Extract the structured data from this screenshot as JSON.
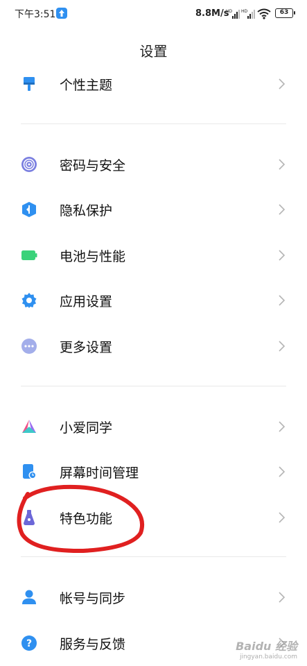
{
  "status_bar": {
    "time": "下午3:51",
    "speed": "8.8M/s",
    "battery": "63",
    "colors": {
      "notification": "#2f90f0"
    }
  },
  "header": {
    "title": "设置"
  },
  "groups": [
    {
      "items": [
        {
          "label": "个性主题",
          "icon": "theme-brush-icon",
          "color": "#2f90f0"
        }
      ]
    },
    {
      "items": [
        {
          "label": "密码与安全",
          "icon": "fingerprint-icon",
          "color": "#7a7fe0"
        },
        {
          "label": "隐私保护",
          "icon": "privacy-shield-icon",
          "color": "#2f90f0"
        },
        {
          "label": "电池与性能",
          "icon": "battery-icon",
          "color": "#3ad27a"
        },
        {
          "label": "应用设置",
          "icon": "gear-icon",
          "color": "#2f90f0"
        },
        {
          "label": "更多设置",
          "icon": "more-dots-icon",
          "color": "#a3aeea"
        }
      ]
    },
    {
      "items": [
        {
          "label": "小爱同学",
          "icon": "xiaoai-icon",
          "color": "#3ec9c9"
        },
        {
          "label": "屏幕时间管理",
          "icon": "screen-time-icon",
          "color": "#2f90f0"
        },
        {
          "label": "特色功能",
          "icon": "feature-flask-icon",
          "color": "#6c67d8"
        }
      ]
    },
    {
      "items": [
        {
          "label": "帐号与同步",
          "icon": "account-icon",
          "color": "#2f90f0"
        },
        {
          "label": "服务与反馈",
          "icon": "help-icon",
          "color": "#2f90f0"
        }
      ]
    }
  ],
  "annotation": {
    "color": "#e02020"
  },
  "watermark": {
    "logo": "Baidu 经验",
    "url": "jingyan.baidu.com"
  }
}
